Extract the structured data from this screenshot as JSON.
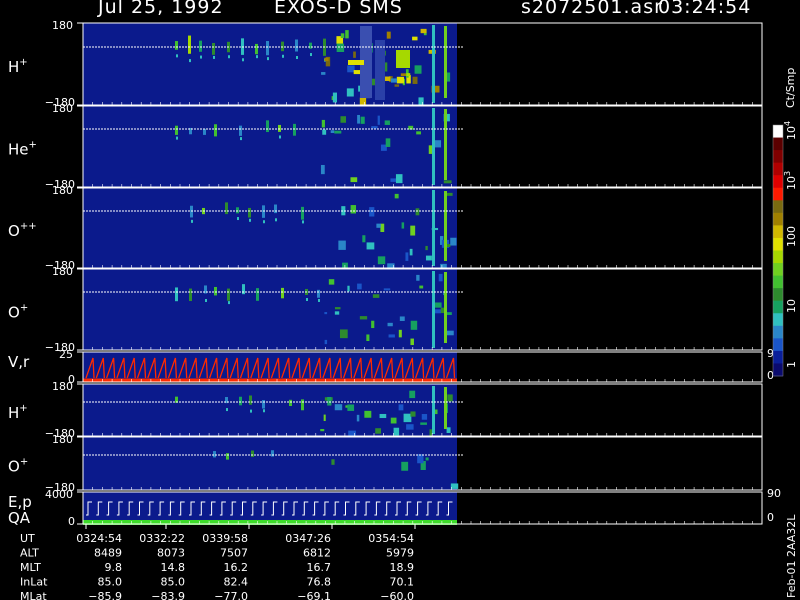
{
  "header": {
    "date": "Jul 25, 1992",
    "instrument": "EXOS-D SMS",
    "file": "s2072501.asr",
    "time": "03:24:54"
  },
  "panels": [
    {
      "label": "H",
      "sup": "+",
      "ymax": "180",
      "ymin": "−180"
    },
    {
      "label": "He",
      "sup": "+",
      "ymax": "180",
      "ymin": "−180"
    },
    {
      "label": "O",
      "sup": "++",
      "ymax": "180",
      "ymin": "−180"
    },
    {
      "label": "O",
      "sup": "+",
      "ymax": "180",
      "ymin": "−180"
    },
    {
      "label": "V,r",
      "sup": "",
      "ymax": "25",
      "ymin": "0",
      "rmax": "90",
      "rmin": "0"
    },
    {
      "label": "H",
      "sup": "+",
      "ymax": "180",
      "ymin": "−180"
    },
    {
      "label": "O",
      "sup": "+",
      "ymax": "180",
      "ymin": "−180"
    },
    {
      "label": "E,p",
      "sup": "",
      "label2": "QA",
      "ymax": "4000",
      "ymin": "0",
      "rmax": "90",
      "rmin": "0"
    }
  ],
  "colorbar": {
    "unit": "Ct/Smp",
    "ticks": [
      "1",
      "10",
      "100",
      "10",
      "10"
    ],
    "tick_sups": [
      "",
      "",
      "",
      "3",
      "4"
    ],
    "colors": [
      "#0a0a6e",
      "#0a1f9a",
      "#1a55c8",
      "#2a86c8",
      "#30c0c0",
      "#16a060",
      "#2e8b2e",
      "#42c030",
      "#70d020",
      "#a6d800",
      "#e0e000",
      "#d0b800",
      "#a08000",
      "#7a6a10",
      "#ff1a00",
      "#e00000",
      "#b00000",
      "#800000",
      "#5a0000",
      "#ffffff"
    ]
  },
  "time_axis": {
    "rows": [
      {
        "label": "UT",
        "values": [
          "0324:54",
          "0332:22",
          "0339:58",
          "0347:26",
          "0354:54"
        ]
      },
      {
        "label": "ALT",
        "values": [
          "8489",
          "8073",
          "7507",
          "6812",
          "5979"
        ]
      },
      {
        "label": "MLT",
        "values": [
          "9.8",
          "14.8",
          "16.2",
          "16.7",
          "18.9"
        ]
      },
      {
        "label": "InLat",
        "values": [
          "85.0",
          "85.0",
          "82.4",
          "76.8",
          "70.1"
        ]
      },
      {
        "label": "MLat",
        "values": [
          "−85.9",
          "−83.9",
          "−77.0",
          "−69.1",
          "−60.0"
        ]
      }
    ]
  },
  "footer": "Feb-01 2AA32L",
  "chart_data": {
    "type": "heatmap",
    "title": "Jul 25, 1992   EXOS-D SMS",
    "x_ticks": [
      "0324:54",
      "0332:22",
      "0339:58",
      "0347:26",
      "0354:54"
    ],
    "panels": [
      {
        "species": "H+",
        "ylim": [
          -180,
          180
        ]
      },
      {
        "species": "He+",
        "ylim": [
          -180,
          180
        ]
      },
      {
        "species": "O++",
        "ylim": [
          -180,
          180
        ]
      },
      {
        "species": "O+",
        "ylim": [
          -180,
          180
        ]
      },
      {
        "species": "V,r",
        "ylim": [
          0,
          25
        ],
        "right_ylim": [
          0,
          90
        ]
      },
      {
        "species": "H+",
        "ylim": [
          -180,
          180
        ]
      },
      {
        "species": "O+",
        "ylim": [
          -180,
          180
        ]
      },
      {
        "species": "E,p / QA",
        "ylim": [
          0,
          4000
        ],
        "right_ylim": [
          0,
          90
        ]
      }
    ],
    "colorbar": {
      "label": "Ct/Smp",
      "scale": "log",
      "ticks": [
        1,
        10,
        100,
        1000,
        10000
      ]
    }
  }
}
